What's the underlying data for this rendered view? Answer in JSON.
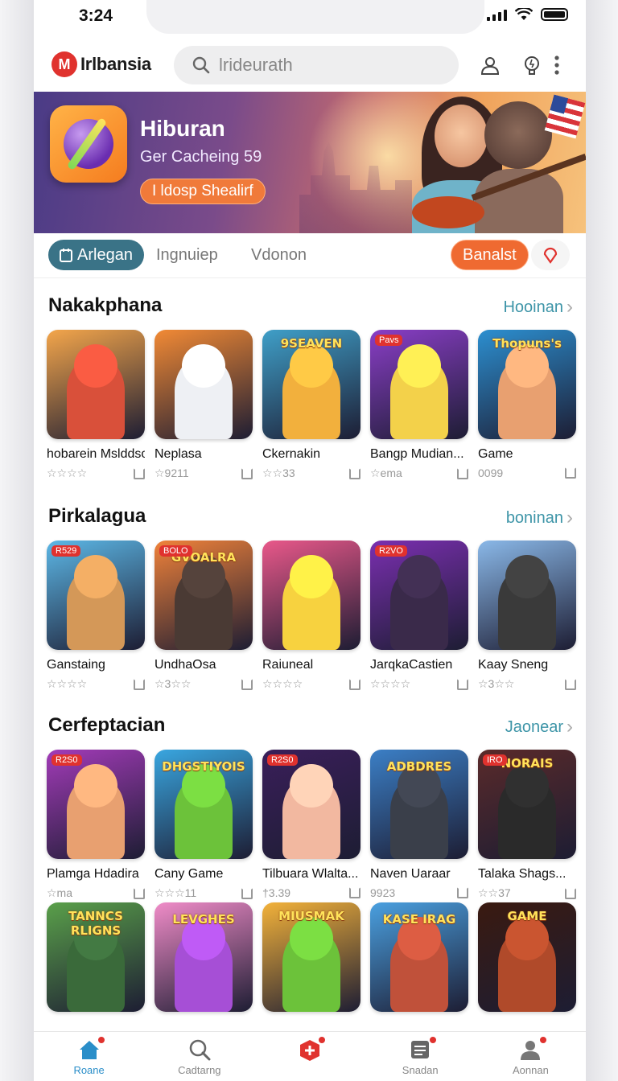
{
  "status_bar": {
    "time": "3:24"
  },
  "header": {
    "logo_mark": "M",
    "logo_text": "Irlbansia",
    "search_placeholder": "lrideurath"
  },
  "banner": {
    "title": "Hiburan",
    "subtitle": "Ger Cacheing 59",
    "cta": "I ldosp Shealirf"
  },
  "tabs": {
    "active": "Arlegan",
    "tab2": "Ingnuiep",
    "tab3": "Vdonon",
    "pill": "Banalst"
  },
  "sections": [
    {
      "title": "Nakakphana",
      "more": "Hooinan",
      "items": [
        {
          "name": "hobarein Mslddso",
          "meta": "☆☆☆☆",
          "color": "#d9503a",
          "bg": "#f4a64b",
          "word": "",
          "badge": ""
        },
        {
          "name": "Neplasa",
          "meta": "☆9211",
          "color": "#eef0f4",
          "bg": "#f28a35",
          "word": "",
          "badge": ""
        },
        {
          "name": "Ckernakin",
          "meta": "☆☆33",
          "color": "#f2b03d",
          "bg": "#3f9fc8",
          "word": "9SEAVEN",
          "badge": ""
        },
        {
          "name": "Bangp Mudian...",
          "meta": "☆ema",
          "color": "#f3d14a",
          "bg": "#8a3ec7",
          "word": "",
          "badge": "Pavs"
        },
        {
          "name": "Game",
          "meta": "0099",
          "color": "#e8a070",
          "bg": "#2c8fd0",
          "word": "Thopuns's",
          "badge": ""
        }
      ]
    },
    {
      "title": "Pirkalagua",
      "more": "boninan",
      "items": [
        {
          "name": "Ganstaing",
          "meta": "☆☆☆☆",
          "color": "#d49858",
          "bg": "#5cb7e6",
          "word": "",
          "badge": "R529"
        },
        {
          "name": "UndhaOsa",
          "meta": "☆3☆☆",
          "color": "#4a3a34",
          "bg": "#f0823a",
          "word": "GVOALRA",
          "badge": "BOLO"
        },
        {
          "name": "Raiuneal",
          "meta": "☆☆☆☆",
          "color": "#f7d23f",
          "bg": "#e9588a",
          "word": "",
          "badge": ""
        },
        {
          "name": "JarqkaCastien",
          "meta": "☆☆☆☆",
          "color": "#3a2a4a",
          "bg": "#7a2fb0",
          "word": "",
          "badge": "R2VO"
        },
        {
          "name": "Kaay Sneng",
          "meta": "☆3☆☆",
          "color": "#3a3a3a",
          "bg": "#8ab8e8",
          "word": "",
          "badge": ""
        }
      ]
    },
    {
      "title": "Cerfeptacian",
      "more": "Jaonear",
      "items": [
        {
          "name": "Plamga Hdadira",
          "meta": "☆ma",
          "color": "#e8a070",
          "bg": "#a23bb8",
          "word": "",
          "badge": "R2S0"
        },
        {
          "name": "Cany Game",
          "meta": "☆☆☆11",
          "color": "#6cc23a",
          "bg": "#39a6e0",
          "word": "DHGSTIYOIS",
          "badge": ""
        },
        {
          "name": "Tilbuara Wlalta...",
          "meta": "†3.39",
          "color": "#f2b8a0",
          "bg": "#3a1f5a",
          "word": "",
          "badge": "R2S0"
        },
        {
          "name": "Naven Uaraar",
          "meta": "9923",
          "color": "#3a3f4a",
          "bg": "#3b7fc6",
          "word": "ADBDRES",
          "badge": ""
        },
        {
          "name": "Talaka Shags...",
          "meta": "☆☆37",
          "color": "#2a2a2a",
          "bg": "#5a2a2a",
          "word": "NORAIS",
          "badge": "IRO"
        }
      ]
    },
    {
      "title": "",
      "more": "",
      "items": [
        {
          "name": "",
          "meta": "",
          "color": "#3a6a3a",
          "bg": "#5aa04a",
          "word": "TANNCS RLIGNS",
          "badge": ""
        },
        {
          "name": "",
          "meta": "",
          "color": "#a64fd6",
          "bg": "#f08cc8",
          "word": "LEVGHES",
          "badge": ""
        },
        {
          "name": "",
          "meta": "",
          "color": "#6cc23a",
          "bg": "#f3b23a",
          "word": "MIUSMAK",
          "badge": ""
        },
        {
          "name": "",
          "meta": "",
          "color": "#c0513a",
          "bg": "#4aa0e0",
          "word": "KASE IRAG",
          "badge": ""
        },
        {
          "name": "",
          "meta": "",
          "color": "#b04a2a",
          "bg": "#3a1a10",
          "word": "GAME",
          "badge": ""
        }
      ]
    }
  ],
  "bottom_nav": [
    {
      "label": "Roane",
      "icon": "home-icon"
    },
    {
      "label": "Cadtarng",
      "icon": "search-icon"
    },
    {
      "label": "",
      "icon": "add-icon"
    },
    {
      "label": "Snadan",
      "icon": "list-icon"
    },
    {
      "label": "Aonnan",
      "icon": "user-icon"
    }
  ],
  "colors": {
    "accent": "#3a7387",
    "orange": "#ef6a31",
    "link": "#3e95a8",
    "badge": "#e0322e"
  }
}
